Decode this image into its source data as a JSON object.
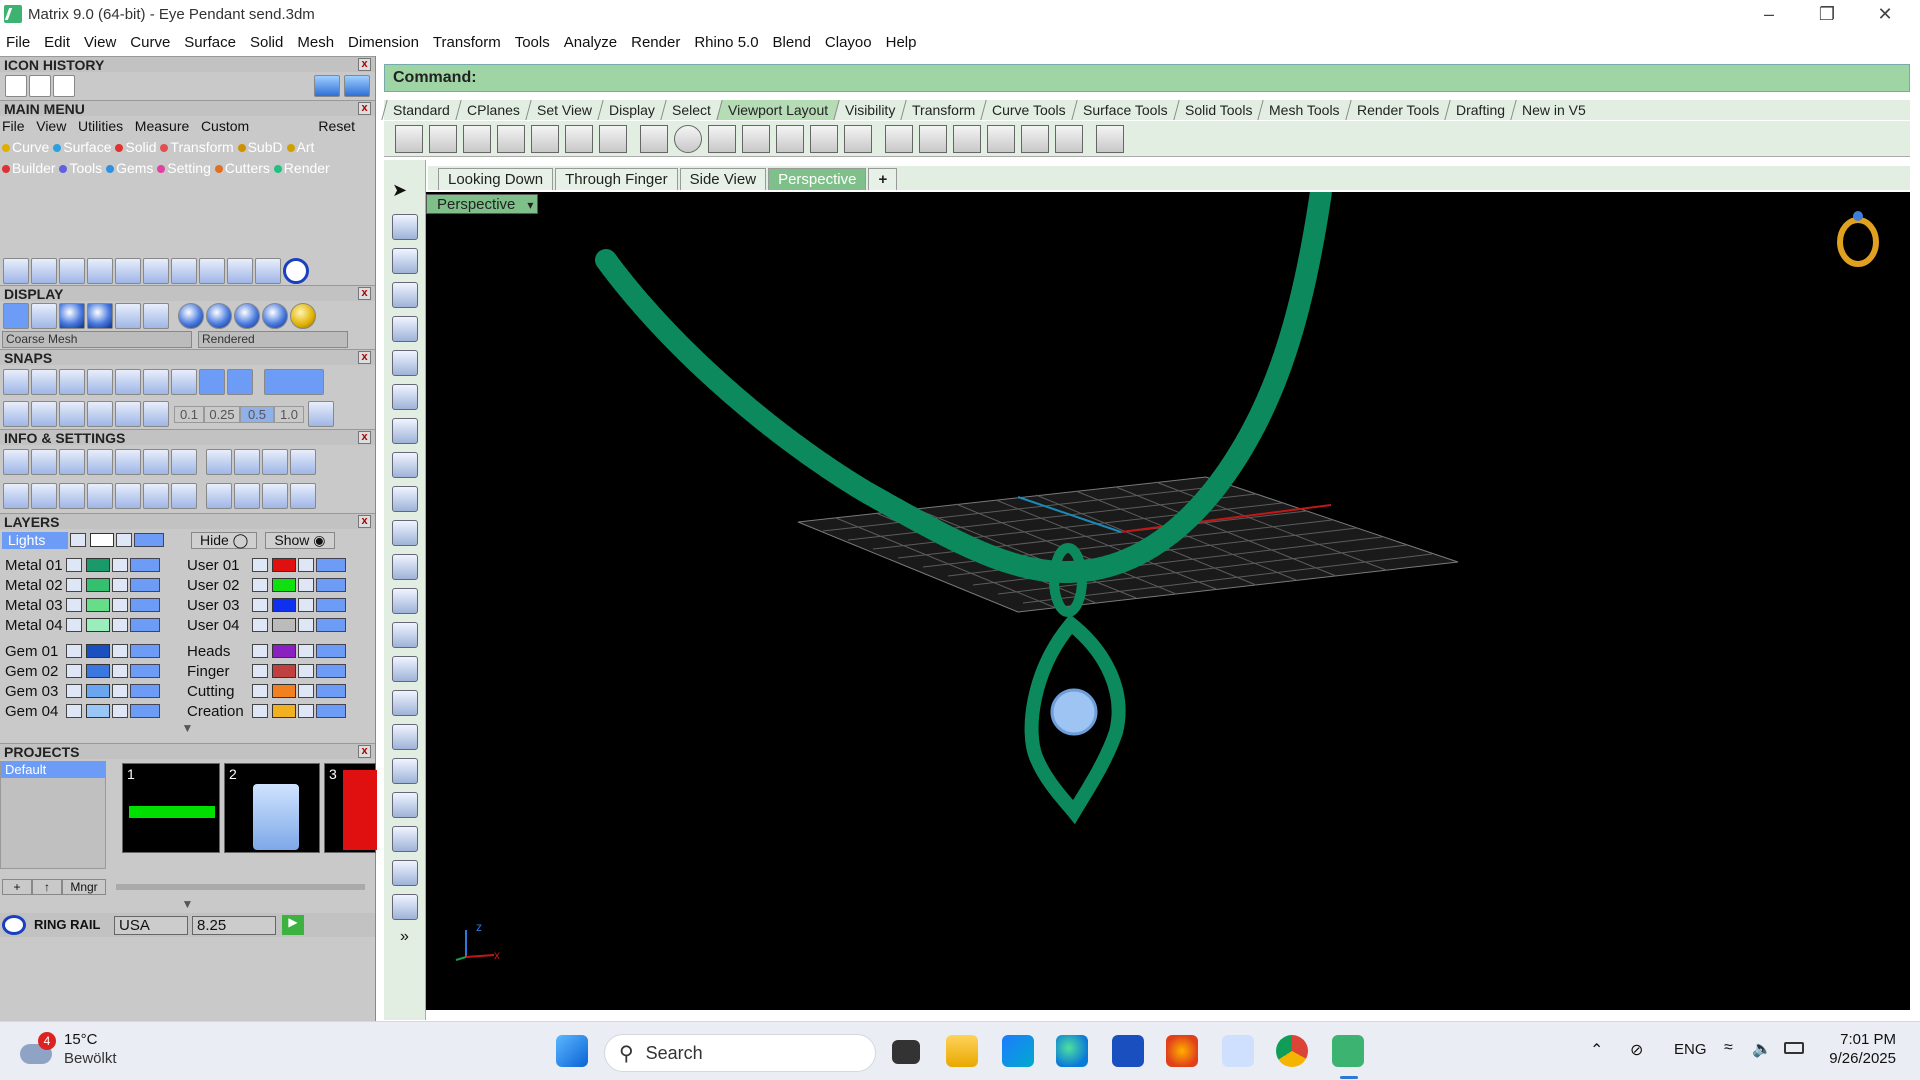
{
  "window": {
    "title": "Matrix 9.0 (64-bit) - Eye Pendant send.3dm"
  },
  "menubar": [
    "File",
    "Edit",
    "View",
    "Curve",
    "Surface",
    "Solid",
    "Mesh",
    "Dimension",
    "Transform",
    "Tools",
    "Analyze",
    "Render",
    "Rhino 5.0",
    "Blend",
    "Clayoo",
    "Help"
  ],
  "panels": {
    "icon_history": "ICON HISTORY",
    "main_menu": "MAIN MENU",
    "display": "DISPLAY",
    "snaps": "SNAPS",
    "info_settings": "INFO & SETTINGS",
    "layers": "LAYERS",
    "projects": "PROJECTS"
  },
  "main_menu": {
    "top": [
      "File",
      "View",
      "Utilities",
      "Measure",
      "Custom"
    ],
    "reset": "Reset",
    "row1": [
      {
        "label": "Curve",
        "color": "#e0b000"
      },
      {
        "label": "Surface",
        "color": "#2aa0e0"
      },
      {
        "label": "Solid",
        "color": "#e03030"
      },
      {
        "label": "Transform",
        "color": "#e05050"
      },
      {
        "label": "SubD",
        "color": "#d09000"
      },
      {
        "label": "Art",
        "color": "#d0a000"
      }
    ],
    "row2": [
      {
        "label": "Builder",
        "color": "#e03030"
      },
      {
        "label": "Tools",
        "color": "#6060e0"
      },
      {
        "label": "Gems",
        "color": "#3090e0"
      },
      {
        "label": "Setting",
        "color": "#e040a0"
      },
      {
        "label": "Cutters",
        "color": "#e07020"
      },
      {
        "label": "Render",
        "color": "#20c080"
      }
    ]
  },
  "display": {
    "mesh": "Coarse Mesh",
    "mode": "Rendered"
  },
  "snaps": {
    "values": [
      "0.1",
      "0.25",
      "0.5",
      "1.0"
    ]
  },
  "layers": {
    "lights_label": "Lights",
    "hide": "Hide",
    "show": "Show",
    "left": [
      {
        "name": "Metal 01",
        "color": "#1a9a6a"
      },
      {
        "name": "Metal 02",
        "color": "#35c070"
      },
      {
        "name": "Metal 03",
        "color": "#66dd88"
      },
      {
        "name": "Metal 04",
        "color": "#99eebb"
      },
      {
        "name": "Gem 01",
        "color": "#1a4fbf"
      },
      {
        "name": "Gem 02",
        "color": "#3a78e0"
      },
      {
        "name": "Gem 03",
        "color": "#6aa6f0"
      },
      {
        "name": "Gem 04",
        "color": "#9ac6f6"
      }
    ],
    "right": [
      {
        "name": "User 01",
        "color": "#e01010"
      },
      {
        "name": "User 02",
        "color": "#10e010"
      },
      {
        "name": "User 03",
        "color": "#1030f0"
      },
      {
        "name": "User 04",
        "color": "#bbbbbb"
      },
      {
        "name": "Heads",
        "color": "#8a20c0"
      },
      {
        "name": "Finger",
        "color": "#c04040"
      },
      {
        "name": "Cutting",
        "color": "#f08020"
      },
      {
        "name": "Creation",
        "color": "#f0b020"
      }
    ]
  },
  "projects": {
    "default": "Default",
    "slots": [
      "1",
      "2",
      "3"
    ],
    "mngr": "Mngr"
  },
  "ring_rail": {
    "label": "RING RAIL",
    "standard": "USA",
    "size": "8.25"
  },
  "command": {
    "label": "Command:"
  },
  "toolbar_tabs": [
    "Standard",
    "CPlanes",
    "Set View",
    "Display",
    "Select",
    "Viewport Layout",
    "Visibility",
    "Transform",
    "Curve Tools",
    "Surface Tools",
    "Solid Tools",
    "Mesh Tools",
    "Render Tools",
    "Drafting",
    "New in V5"
  ],
  "toolbar_tabs_active": "Viewport Layout",
  "viewport_tabs": [
    "Looking Down",
    "Through Finger",
    "Side View",
    "Perspective"
  ],
  "viewport_active": "Perspective",
  "viewport_label": "Perspective",
  "axes": {
    "x": "x",
    "z": "z"
  },
  "colors": {
    "necklace": "#0c8a5e",
    "gem": "#9ec4f4",
    "grid": "#6a6a6a",
    "ring_icon": "#e0a020"
  },
  "taskbar": {
    "weather_temp": "15°C",
    "weather_desc": "Bewölkt",
    "weather_badge": "4",
    "search": "Search",
    "lang": "ENG",
    "time": "7:01 PM",
    "date": "9/26/2025"
  }
}
